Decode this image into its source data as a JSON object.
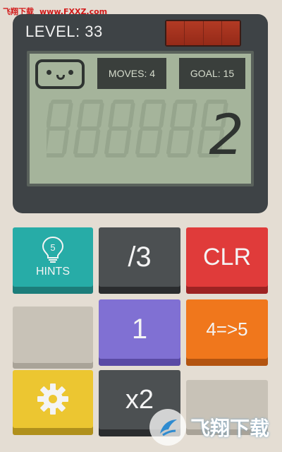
{
  "watermark_top": {
    "site_name": "飞翔下载",
    "url": "www.FXXZ.com"
  },
  "header": {
    "level_label": "LEVEL: 33"
  },
  "display": {
    "moves_label": "MOVES: 4",
    "goal_label": "GOAL: 15",
    "current_value": "2"
  },
  "buttons": {
    "hints": {
      "count": "5",
      "label": "HINTS"
    },
    "divide": "/3",
    "clear": "CLR",
    "one": "1",
    "convert": "4=>5",
    "double": "x2"
  },
  "icons": {
    "hint": "lightbulb-icon",
    "settings": "gear-icon",
    "face": "robot-face-icon"
  },
  "colors": {
    "hints": "#27aca7",
    "operation": "#4c5052",
    "clear": "#e03b3a",
    "number": "#8070d3",
    "convert": "#f0771c",
    "settings": "#ecc631",
    "empty": "#c8c2b7",
    "screen": "#a5b49b"
  },
  "watermark_bottom": {
    "text": "飞翔下载"
  }
}
